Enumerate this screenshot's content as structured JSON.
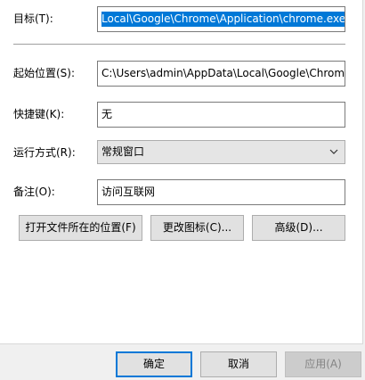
{
  "target": {
    "label": "目标(T):",
    "value": "Local\\Google\\Chrome\\Application\\chrome.exe"
  },
  "start_in": {
    "label": "起始位置(S):",
    "value": "C:\\Users\\admin\\AppData\\Local\\Google\\Chrom"
  },
  "shortcut_key": {
    "label": "快捷键(K):",
    "value": "无"
  },
  "run": {
    "label": "运行方式(R):",
    "value": "常规窗口"
  },
  "comment": {
    "label": "备注(O):",
    "value": "访问互联网"
  },
  "actions": {
    "open_location": "打开文件所在的位置(F)",
    "change_icon": "更改图标(C)...",
    "advanced": "高级(D)..."
  },
  "footer": {
    "ok": "确定",
    "cancel": "取消",
    "apply": "应用(A)"
  }
}
